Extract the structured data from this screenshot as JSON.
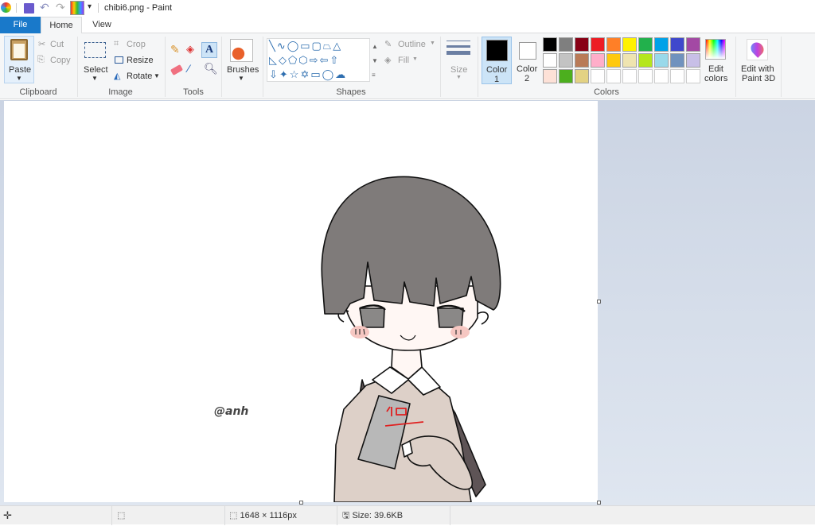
{
  "window": {
    "title": "chibi6.png - Paint"
  },
  "tabs": [
    {
      "label": "File"
    },
    {
      "label": "Home"
    },
    {
      "label": "View"
    }
  ],
  "clipboard": {
    "group": "Clipboard",
    "paste": "Paste",
    "cut": "Cut",
    "copy": "Copy"
  },
  "image": {
    "group": "Image",
    "select": "Select",
    "crop": "Crop",
    "resize": "Resize",
    "rotate": "Rotate"
  },
  "tools": {
    "group": "Tools"
  },
  "brushes": {
    "label": "Brushes"
  },
  "shapes": {
    "group": "Shapes",
    "outline": "Outline",
    "fill": "Fill"
  },
  "size": {
    "label": "Size"
  },
  "colors": {
    "group": "Colors",
    "color1": "Color",
    "color1_num": "1",
    "color2": "Color",
    "color2_num": "2",
    "edit": "Edit",
    "edit2": "colors",
    "palette": [
      "#000000",
      "#7f7f7f",
      "#880015",
      "#ed1c24",
      "#ff7f27",
      "#fff200",
      "#22b14c",
      "#00a2e8",
      "#3f48cc",
      "#a349a4",
      "#ffffff",
      "#c3c3c3",
      "#b97a57",
      "#ffaec9",
      "#ffc90e",
      "#efe4b0",
      "#b5e61d",
      "#99d9ea",
      "#7092be",
      "#c8bfe7",
      "#fde1d7",
      "#4caf1e",
      "#e3d283",
      "#ffffff",
      "#ffffff",
      "#ffffff",
      "#ffffff",
      "#ffffff",
      "#ffffff",
      "#ffffff"
    ]
  },
  "paint3d": {
    "line1": "Edit with",
    "line2": "Paint 3D"
  },
  "canvas": {
    "watermark": "@anh",
    "book_text": "기요"
  },
  "status": {
    "dimensions": "1648 × 1116px",
    "size": "Size: 39.6KB"
  }
}
